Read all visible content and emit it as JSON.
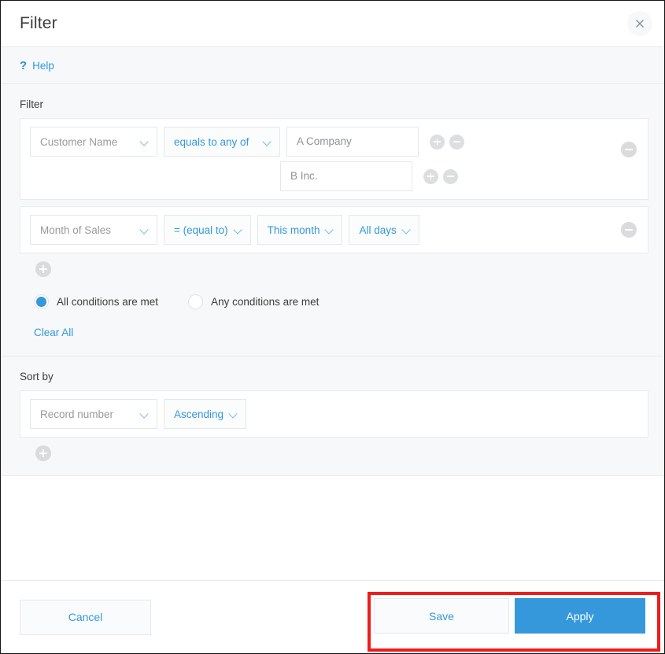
{
  "header": {
    "title": "Filter",
    "close_icon": "close-icon"
  },
  "help_bar": {
    "icon": "question-mark-icon",
    "label": "Help"
  },
  "filter_section": {
    "label": "Filter",
    "conditions": [
      {
        "field": "Customer Name",
        "operator": "equals to any of",
        "values": [
          "A Company",
          "B Inc."
        ]
      },
      {
        "field": "Month of Sales",
        "operator": "= (equal to)",
        "period": "This month",
        "days": "All days"
      }
    ],
    "add_condition_icon": "plus-icon",
    "remove_condition_icon": "minus-icon",
    "add_value_icon": "plus-icon",
    "remove_value_icon": "minus-icon",
    "match_options": [
      {
        "label": "All conditions are met",
        "selected": true
      },
      {
        "label": "Any conditions are met",
        "selected": false
      }
    ],
    "clear_all_label": "Clear All"
  },
  "sort_section": {
    "label": "Sort by",
    "field": "Record number",
    "direction": "Ascending",
    "add_sort_icon": "plus-icon"
  },
  "footer": {
    "cancel_label": "Cancel",
    "save_label": "Save",
    "apply_label": "Apply"
  },
  "colors": {
    "accent": "#3498db",
    "highlight": "#ee1c1c",
    "panel_bg": "#f7f8f9",
    "text": "#3d3d3d",
    "muted_text": "#9a9a9a"
  }
}
